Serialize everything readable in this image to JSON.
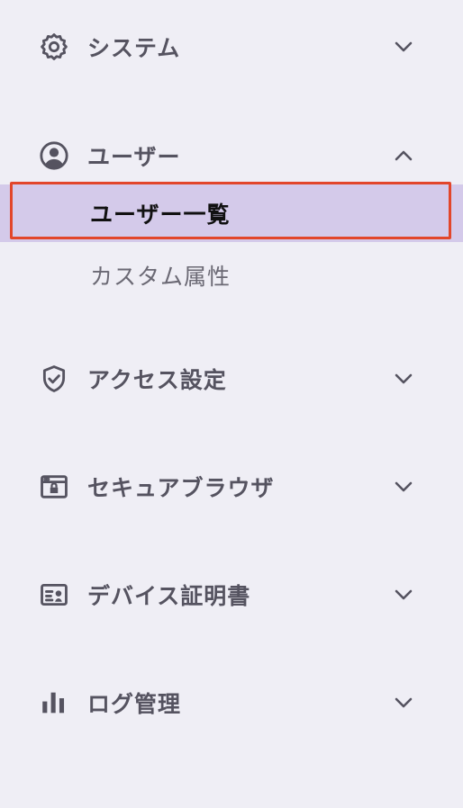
{
  "sidebar": {
    "sections": [
      {
        "label": "システム",
        "icon": "gear-icon",
        "expanded": false
      },
      {
        "label": "ユーザー",
        "icon": "user-circle-icon",
        "expanded": true,
        "children": [
          {
            "label": "ユーザー一覧",
            "active": true
          },
          {
            "label": "カスタム属性",
            "active": false
          }
        ]
      },
      {
        "label": "アクセス設定",
        "icon": "shield-check-icon",
        "expanded": false
      },
      {
        "label": "セキュアブラウザ",
        "icon": "browser-lock-icon",
        "expanded": false
      },
      {
        "label": "デバイス証明書",
        "icon": "certificate-card-icon",
        "expanded": false
      },
      {
        "label": "ログ管理",
        "icon": "bar-chart-icon",
        "expanded": false
      }
    ]
  },
  "colors": {
    "background": "#efeef5",
    "active_background": "#d4caea",
    "highlight_border": "#e2462b",
    "icon": "#555360"
  }
}
